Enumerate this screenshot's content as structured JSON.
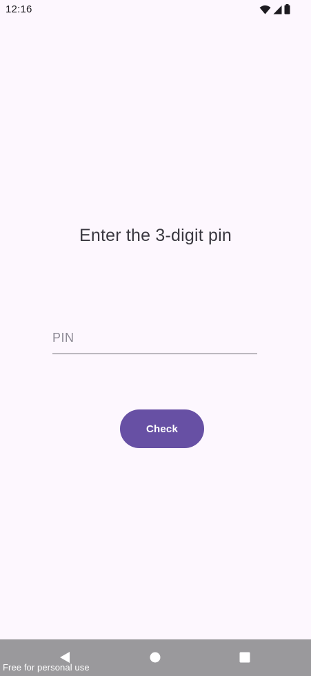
{
  "status_bar": {
    "time": "12:16",
    "icons": [
      "wifi-icon",
      "cell-signal-icon",
      "battery-icon"
    ]
  },
  "screen": {
    "title": "Enter the 3-digit pin",
    "pin_input": {
      "value": "",
      "placeholder": "PIN"
    },
    "check_button_label": "Check"
  },
  "nav_bar": {
    "buttons": [
      "back-icon",
      "home-icon",
      "recents-icon"
    ]
  },
  "watermark": "Free for personal use",
  "colors": {
    "background": "#fdf7fe",
    "accent": "#6750a4",
    "nav_bar": "#9a999c"
  }
}
